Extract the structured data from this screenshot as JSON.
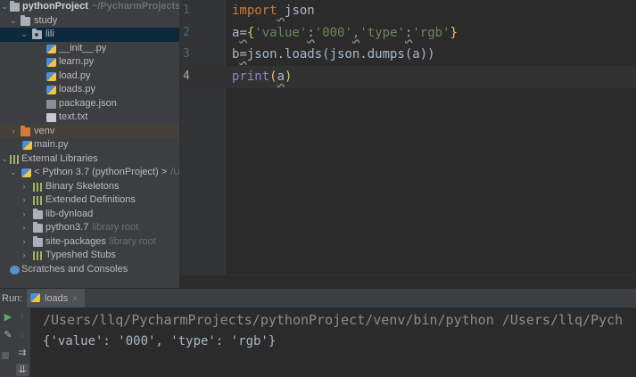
{
  "project_tree": {
    "root": {
      "name": "pythonProject",
      "path": "~/PycharmProjects/p"
    },
    "study": "study",
    "lili": "lili",
    "files": [
      "__init__.py",
      "learn.py",
      "load.py",
      "loads.py",
      "package.json",
      "text.txt"
    ],
    "venv": "venv",
    "main_py": "main.py",
    "external_libraries": "External Libraries",
    "python_sdk": {
      "name": "< Python 3.7 (pythonProject) >",
      "hint": "/U"
    },
    "libs": [
      {
        "name": "Binary Skeletons",
        "hint": ""
      },
      {
        "name": "Extended Definitions",
        "hint": ""
      },
      {
        "name": "lib-dynload",
        "hint": ""
      },
      {
        "name": "python3.7",
        "hint": "library root"
      },
      {
        "name": "site-packages",
        "hint": "library root"
      },
      {
        "name": "Typeshed Stubs",
        "hint": ""
      }
    ],
    "scratches": "Scratches and Consoles"
  },
  "editor": {
    "line_numbers": [
      "1",
      "2",
      "3",
      "4"
    ],
    "line1": {
      "kw": "import",
      "mod": "json"
    },
    "line2": {
      "var": "a",
      "eq": "=",
      "ob": "{",
      "k1": "'value'",
      "c1": ":",
      "v1": "'000'",
      "comma": ",",
      "k2": "'type'",
      "c2": ":",
      "v2": "'rgb'",
      "cb": "}"
    },
    "line3": {
      "var": "b",
      "eq": "=",
      "rest": "json.loads(json.dumps(a))"
    },
    "line4": {
      "fn": "print",
      "op": "(",
      "arg": "a",
      "cp": ")"
    }
  },
  "run_panel": {
    "label": "Run:",
    "tab": "loads",
    "tab_close": "×",
    "command": "/Users/llq/PycharmProjects/pythonProject/venv/bin/python /Users/llq/Pych",
    "output": "{'value': '000', 'type': 'rgb'}"
  }
}
